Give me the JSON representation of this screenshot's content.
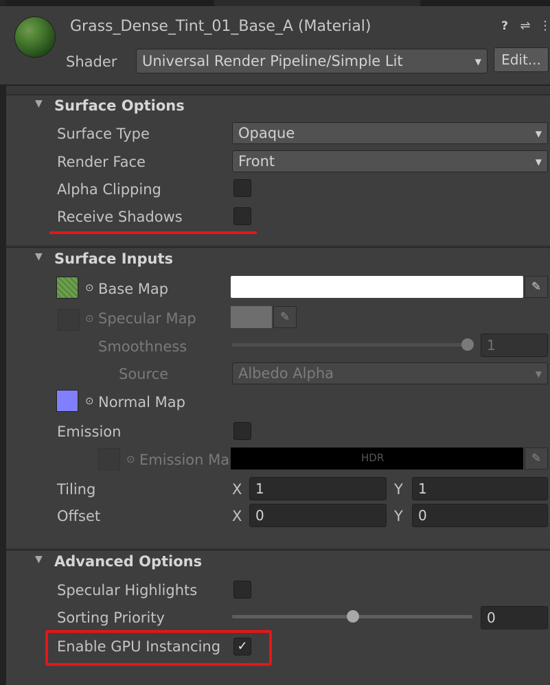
{
  "header": {
    "title": "Grass_Dense_Tint_01_Base_A (Material)",
    "shader_label": "Shader",
    "shader_value": "Universal Render Pipeline/Simple Lit",
    "edit_label": "Edit..."
  },
  "surface_options": {
    "title": "Surface Options",
    "surface_type_label": "Surface Type",
    "surface_type_value": "Opaque",
    "render_face_label": "Render Face",
    "render_face_value": "Front",
    "alpha_clipping_label": "Alpha Clipping",
    "alpha_clipping_checked": false,
    "receive_shadows_label": "Receive Shadows",
    "receive_shadows_checked": false
  },
  "surface_inputs": {
    "title": "Surface Inputs",
    "base_map_label": "Base Map",
    "specular_map_label": "Specular Map",
    "smoothness_label": "Smoothness",
    "smoothness_value": "1",
    "source_label": "Source",
    "source_value": "Albedo Alpha",
    "normal_map_label": "Normal Map",
    "emission_label": "Emission",
    "emission_checked": false,
    "emission_map_label": "Emission Ma",
    "hdr_label": "HDR",
    "tiling_label": "Tiling",
    "tiling_x": "1",
    "tiling_y": "1",
    "offset_label": "Offset",
    "offset_x": "0",
    "offset_y": "0",
    "x_label": "X",
    "y_label": "Y"
  },
  "advanced_options": {
    "title": "Advanced Options",
    "specular_highlights_label": "Specular Highlights",
    "specular_highlights_checked": false,
    "sorting_priority_label": "Sorting Priority",
    "sorting_priority_value": "0",
    "gpu_instancing_label": "Enable GPU Instancing",
    "gpu_instancing_checked": true,
    "checkmark": "✓"
  },
  "colors": {
    "highlight_red": "#e81515",
    "base_map_color": "#ffffff",
    "normal_map_thumb": "#8080ff",
    "background": "#383838"
  },
  "icons": {
    "collapse_triangle": "▼",
    "dropdown_arrow": "▼",
    "help": "❓",
    "preset": "⇆",
    "kebab": "⋮",
    "eyedropper": "✎",
    "target": "⊙"
  }
}
